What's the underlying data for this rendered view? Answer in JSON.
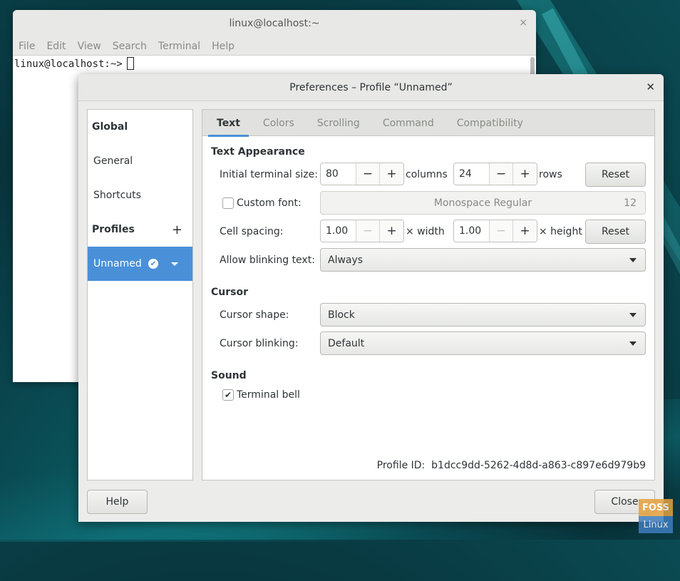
{
  "terminal": {
    "title": "linux@localhost:~",
    "menu": [
      "File",
      "Edit",
      "View",
      "Search",
      "Terminal",
      "Help"
    ],
    "prompt": "linux@localhost:~>",
    "close_icon": "×"
  },
  "dialog": {
    "title": "Preferences – Profile “Unnamed”",
    "close_icon": "✕",
    "sidebar": {
      "global": "Global",
      "general": "General",
      "shortcuts": "Shortcuts",
      "profiles": "Profiles",
      "add_icon": "+",
      "profile_name": "Unnamed",
      "default_check": "✔"
    },
    "tabs": [
      "Text",
      "Colors",
      "Scrolling",
      "Command",
      "Compatibility"
    ],
    "text_appearance": {
      "heading": "Text Appearance",
      "initial_size_label": "Initial terminal size:",
      "columns_value": "80",
      "columns_unit": "columns",
      "rows_value": "24",
      "rows_unit": "rows",
      "minus": "−",
      "plus": "+",
      "reset_label": "Reset",
      "custom_font_label": "Custom font:",
      "custom_font_checked": false,
      "font_name": "Monospace Regular",
      "font_size": "12",
      "cell_spacing_label": "Cell spacing:",
      "width_value": "1.00",
      "width_unit": "× width",
      "height_value": "1.00",
      "height_unit": "× height",
      "blinking_label": "Allow blinking text:",
      "blinking_value": "Always"
    },
    "cursor": {
      "heading": "Cursor",
      "shape_label": "Cursor shape:",
      "shape_value": "Block",
      "blinking_label": "Cursor blinking:",
      "blinking_value": "Default"
    },
    "sound": {
      "heading": "Sound",
      "bell_label": "Terminal bell",
      "bell_checked": true,
      "check_glyph": "✔"
    },
    "profile_id_label": "Profile ID:",
    "profile_id": "b1dcc9dd-5262-4d8d-a863-c897e6d979b9",
    "help_label": "Help",
    "close_label": "Close"
  },
  "watermark": {
    "top": "FOSS",
    "bottom": "Linux"
  },
  "colors": {
    "accent": "#4a90d9",
    "window_bg": "#ececeb"
  }
}
